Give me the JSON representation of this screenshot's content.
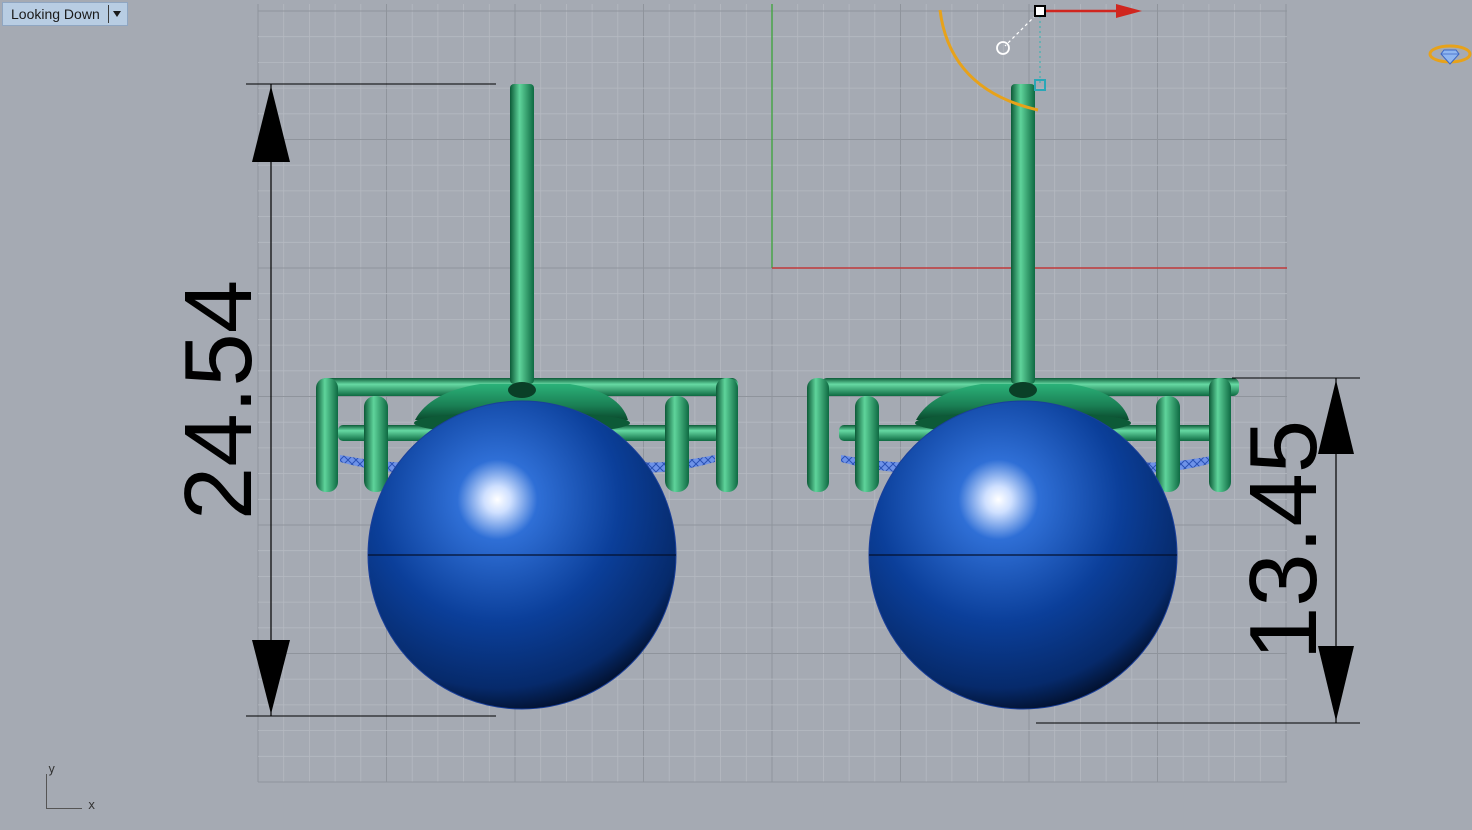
{
  "viewport": {
    "name": "Looking Down",
    "dropdown_icon": "dropdown-arrow-icon",
    "axis_labels": {
      "x": "x",
      "y": "y"
    },
    "display_icon": "gem-ring-icon"
  },
  "dimensions": [
    {
      "id": "overall-height",
      "value": "24.54"
    },
    {
      "id": "sphere-height",
      "value": "13.45"
    }
  ],
  "colors": {
    "background": "#a5aab3",
    "grid_minor": "#b5b9c1",
    "grid_major": "#8f949c",
    "x_axis": "#c0393b",
    "y_axis": "#4aa44a",
    "model_green": "#1e8f5e",
    "sphere_blue": "#0b3f9a",
    "gumball": "#e7a21a"
  }
}
